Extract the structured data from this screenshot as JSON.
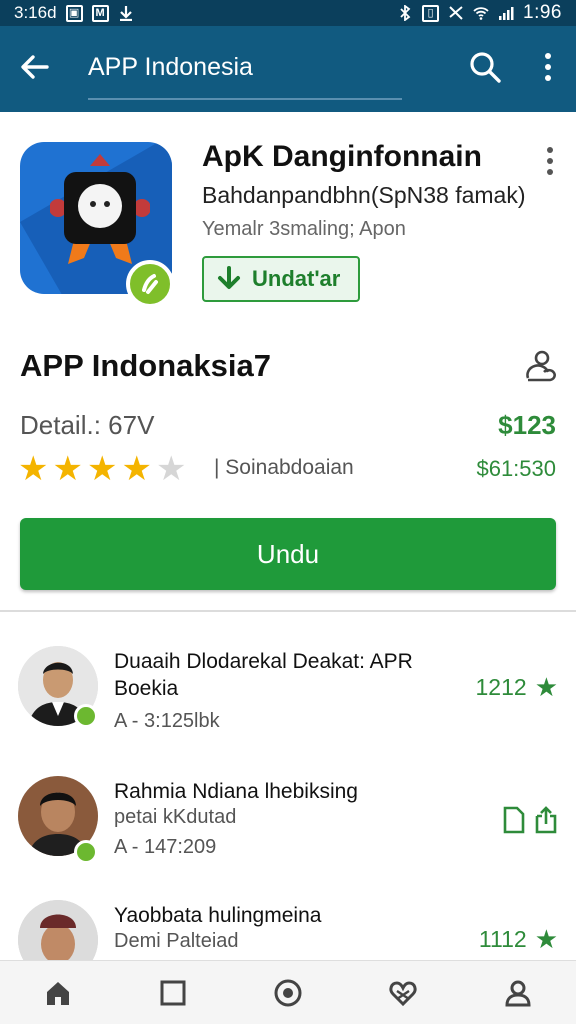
{
  "status_bar": {
    "time": "1:96",
    "left_text": "3:16d",
    "icons": [
      "image-icon",
      "mail-icon",
      "download-arrow-icon",
      "bluetooth-icon",
      "vibrate-icon",
      "no-signal-icon",
      "wifi-icon",
      "cell-signal-icon"
    ]
  },
  "app_bar": {
    "title": "APP Indonesia",
    "icons": [
      "back-arrow-icon",
      "search-icon",
      "more-vert-icon"
    ]
  },
  "app": {
    "name": "ApK Danginfonnain",
    "developer": "Bahdanpandbhn(SpN38 famak)",
    "subtitle": "Yemalr 3smaling; Apon",
    "update_label": "Undat'ar"
  },
  "section": {
    "title": "APP Indonaksia7",
    "detail_label": "Detail.: 67V",
    "price": "$123",
    "rating": 3.5,
    "rating_meta": "| Soinabdoaian",
    "price_secondary": "$61:530",
    "download_label": "Undu"
  },
  "list_items": [
    {
      "title": "Duaaih Dlodarekal Deakat: APR Boekia",
      "subtitle": "A - 3:125lbk",
      "score": "1212",
      "action": "star"
    },
    {
      "title": "Rahmia Ndiana lhebiksing",
      "subtitle": "petai kKdutad",
      "subtitle2": "A - 147:209",
      "score": "",
      "action": "doc-icons"
    },
    {
      "title": "Yaobbata hulingmeina",
      "subtitle": "Demi Palteiad",
      "score": "1112",
      "action": "star"
    }
  ],
  "bottom_nav": [
    "home-icon",
    "square-icon",
    "record-icon",
    "heart-icon",
    "profile-icon"
  ],
  "colors": {
    "app_bar": "#115a80",
    "status_bar": "#0b3f5c",
    "accent_green": "#1f9a3a",
    "price_green": "#2e8b3a",
    "star": "#f4b400"
  }
}
